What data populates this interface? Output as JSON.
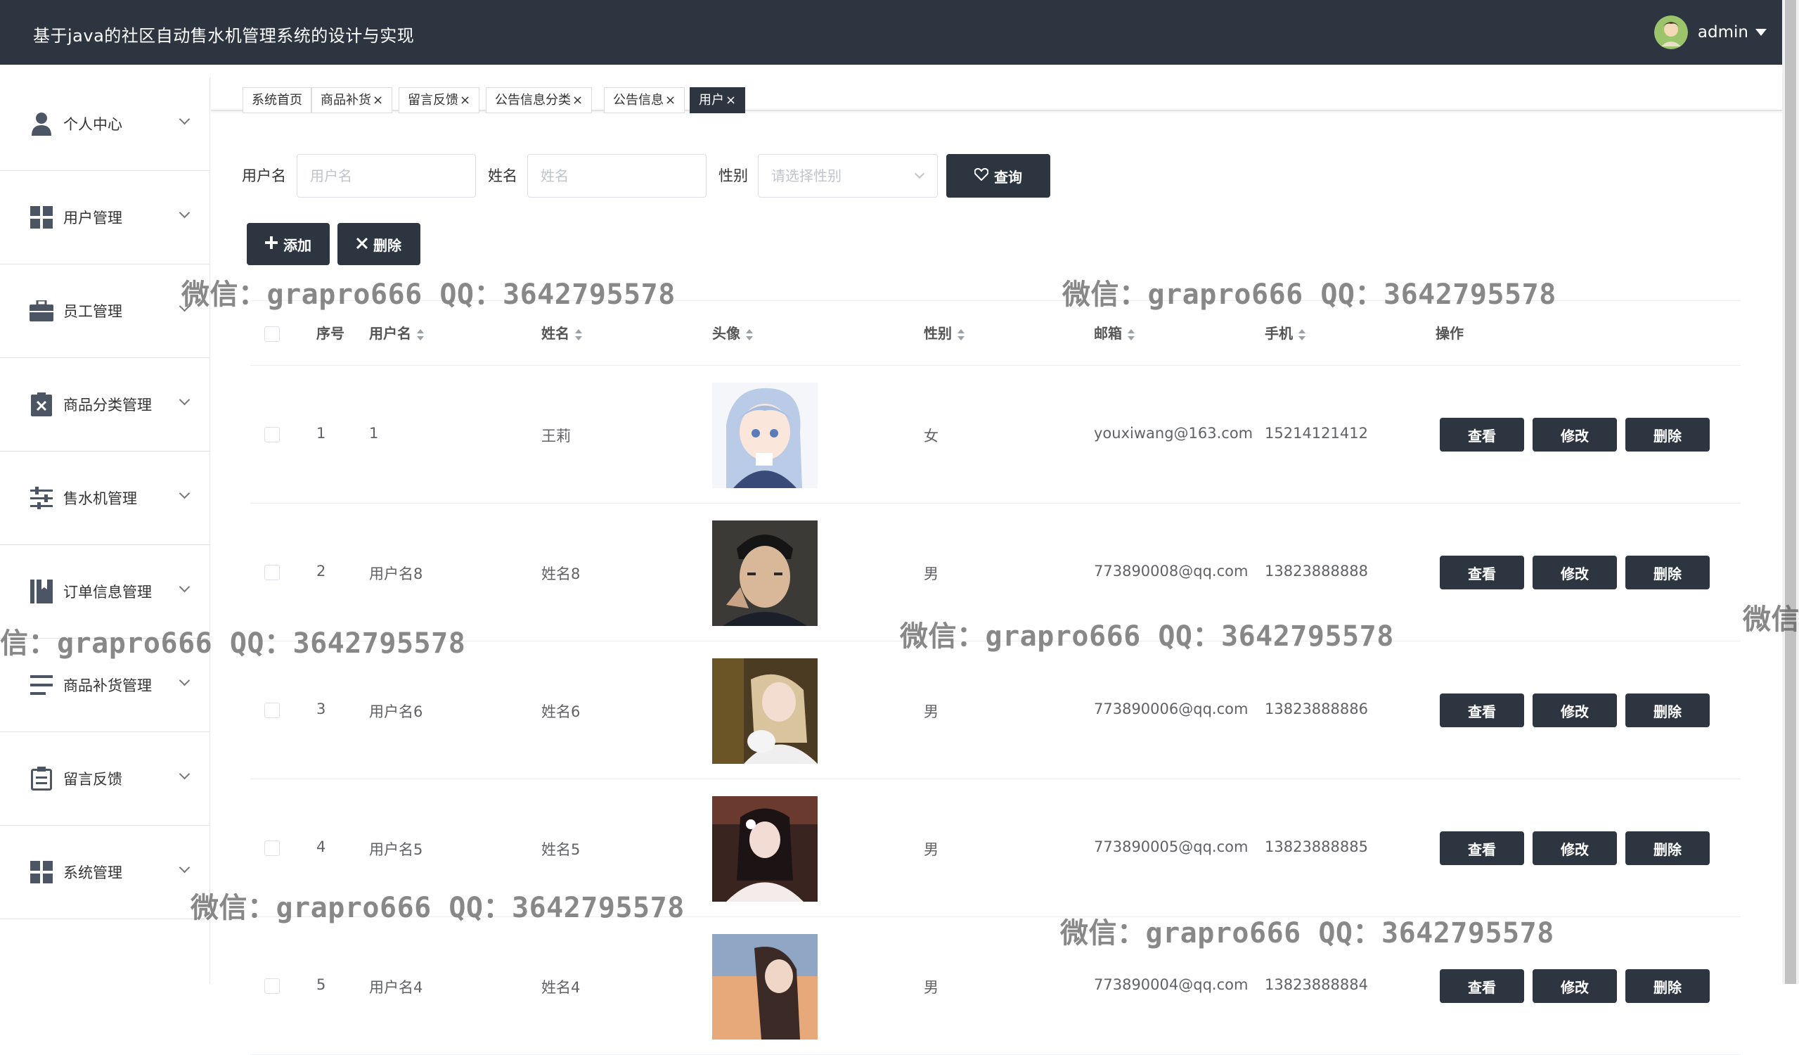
{
  "header": {
    "title": "基于java的社区自动售水机管理系统的设计与实现",
    "username": "admin"
  },
  "sidebar": {
    "items": [
      {
        "label": "个人中心",
        "icon": "user-icon"
      },
      {
        "label": "用户管理",
        "icon": "grid-icon"
      },
      {
        "label": "员工管理",
        "icon": "briefcase-icon"
      },
      {
        "label": "商品分类管理",
        "icon": "clipboard-x-icon"
      },
      {
        "label": "售水机管理",
        "icon": "sliders-icon"
      },
      {
        "label": "订单信息管理",
        "icon": "book-icon"
      },
      {
        "label": "商品补货管理",
        "icon": "list-icon"
      },
      {
        "label": "留言反馈",
        "icon": "clipboard-icon"
      },
      {
        "label": "系统管理",
        "icon": "grid-icon"
      }
    ]
  },
  "tabs": [
    {
      "label": "系统首页",
      "closable": false,
      "active": false
    },
    {
      "label": "商品补货",
      "closable": true,
      "active": false
    },
    {
      "label": "留言反馈",
      "closable": true,
      "active": false
    },
    {
      "label": "公告信息分类",
      "closable": true,
      "active": false
    },
    {
      "label": "公告信息",
      "closable": true,
      "active": false
    },
    {
      "label": "用户",
      "closable": true,
      "active": true
    }
  ],
  "close_glyph": "×",
  "search": {
    "username_label": "用户名",
    "username_placeholder": "用户名",
    "name_label": "姓名",
    "name_placeholder": "姓名",
    "gender_label": "性别",
    "gender_placeholder": "请选择性别",
    "query_button": "查询"
  },
  "actions": {
    "add_button": "添加",
    "delete_button": "删除"
  },
  "table": {
    "columns": [
      "序号",
      "用户名",
      "姓名",
      "头像",
      "性别",
      "邮箱",
      "手机",
      "操作"
    ],
    "row_buttons": {
      "view": "查看",
      "edit": "修改",
      "delete": "删除"
    },
    "rows": [
      {
        "index": "1",
        "username": "1",
        "name": "王莉",
        "gender": "女",
        "email": "youxiwang@163.com",
        "phone": "15214121412"
      },
      {
        "index": "2",
        "username": "用户名8",
        "name": "姓名8",
        "gender": "男",
        "email": "773890008@qq.com",
        "phone": "13823888888"
      },
      {
        "index": "3",
        "username": "用户名6",
        "name": "姓名6",
        "gender": "男",
        "email": "773890006@qq.com",
        "phone": "13823888886"
      },
      {
        "index": "4",
        "username": "用户名5",
        "name": "姓名5",
        "gender": "男",
        "email": "773890005@qq.com",
        "phone": "13823888885"
      },
      {
        "index": "5",
        "username": "用户名4",
        "name": "姓名4",
        "gender": "男",
        "email": "773890004@qq.com",
        "phone": "13823888884"
      }
    ]
  },
  "watermark_text": "微信：grapro666 QQ：3642795578",
  "watermark_partial_left": "信：grapro666 QQ：3642795578",
  "watermark_partial_right": "微信",
  "theme": {
    "primary": "#2d3540",
    "border": "#ebeef5"
  }
}
